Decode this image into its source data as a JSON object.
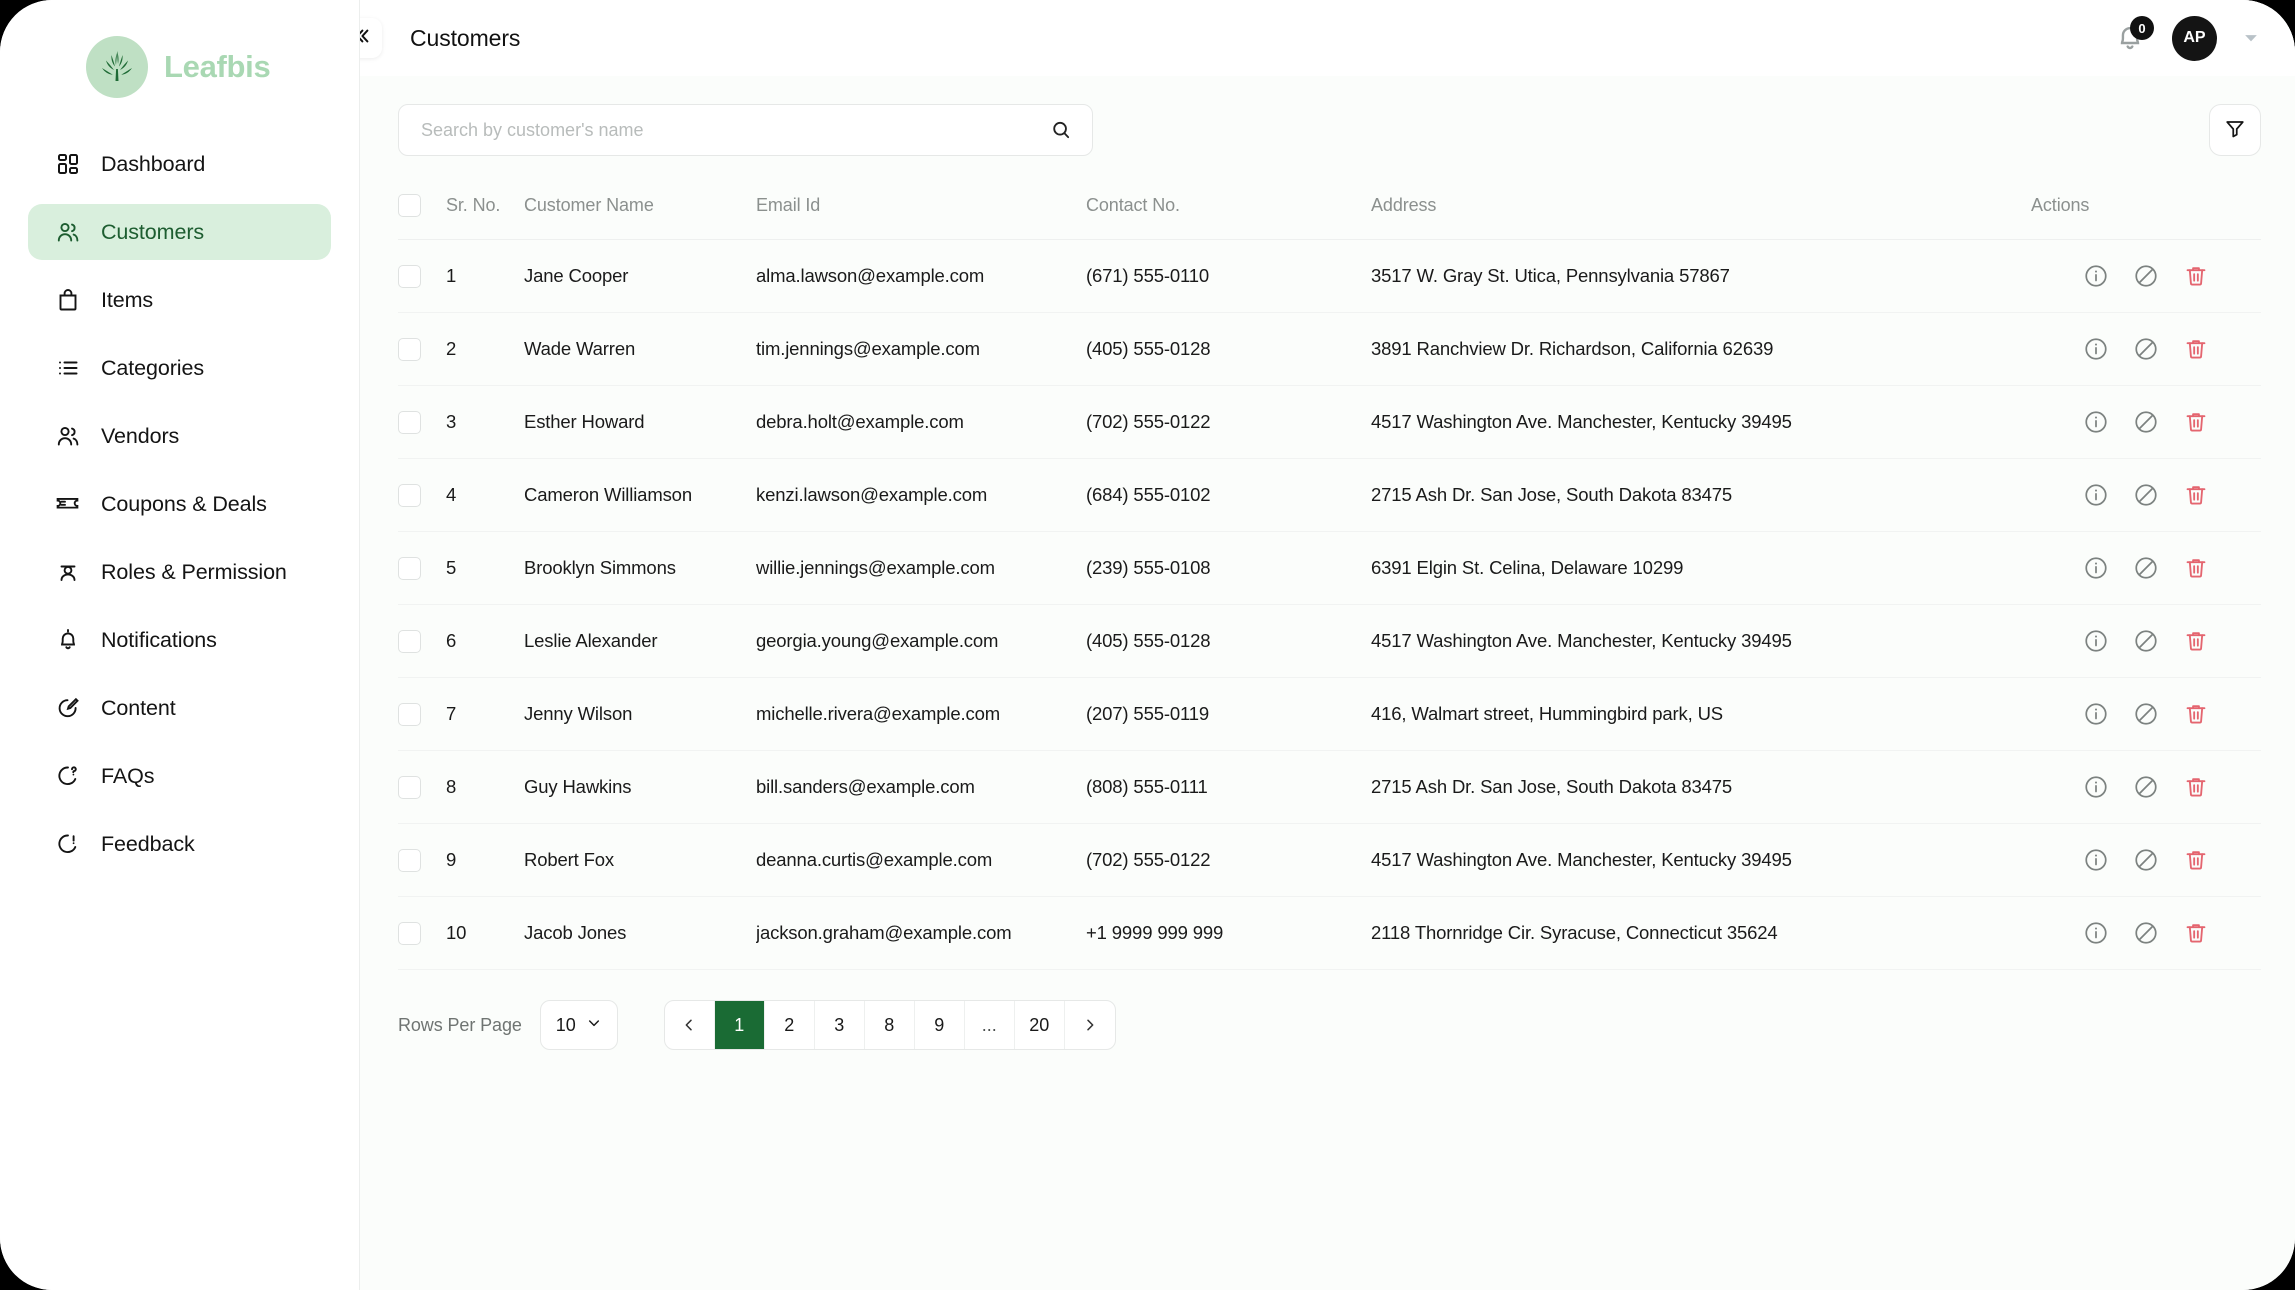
{
  "brand": {
    "name": "Leafbis",
    "logo_icon": "cannabis-leaf-icon",
    "logo_bg": "#bfe0c4",
    "text_color": "#a9d8b3"
  },
  "sidebar": {
    "items": [
      {
        "label": "Dashboard",
        "icon": "grid-dashboard-icon",
        "active": false
      },
      {
        "label": "Customers",
        "icon": "users-icon",
        "active": true
      },
      {
        "label": "Items",
        "icon": "bag-icon",
        "active": false
      },
      {
        "label": "Categories",
        "icon": "list-icon",
        "active": false
      },
      {
        "label": "Vendors",
        "icon": "users-icon",
        "active": false
      },
      {
        "label": "Coupons & Deals",
        "icon": "ticket-icon",
        "active": false
      },
      {
        "label": "Roles & Permission",
        "icon": "user-badge-icon",
        "active": false
      },
      {
        "label": "Notifications",
        "icon": "bell-icon",
        "active": false
      },
      {
        "label": "Content",
        "icon": "pencil-edit-icon",
        "active": false
      },
      {
        "label": "FAQs",
        "icon": "question-chat-icon",
        "active": false
      },
      {
        "label": "Feedback",
        "icon": "feedback-chat-icon",
        "active": false
      }
    ]
  },
  "header": {
    "title": "Customers",
    "collapse_icon": "double-chevron-left-icon",
    "notification_icon": "bell-icon",
    "notification_count": "0",
    "avatar_initials": "AP",
    "caret_icon": "chevron-down-icon"
  },
  "toolbar": {
    "search_placeholder": "Search by customer's name",
    "search_value": "",
    "search_icon": "search-icon",
    "filter_icon": "filter-funnel-icon"
  },
  "table": {
    "columns": [
      "Sr. No.",
      "Customer Name",
      "Email Id",
      "Contact No.",
      "Address",
      "Actions"
    ],
    "action_icons": [
      "info-circle-icon",
      "block-ban-icon",
      "trash-delete-icon"
    ],
    "rows": [
      {
        "sr": "1",
        "name": "Jane Cooper",
        "email": "alma.lawson@example.com",
        "phone": "(671) 555-0110",
        "address": "3517 W. Gray St. Utica, Pennsylvania 57867"
      },
      {
        "sr": "2",
        "name": "Wade Warren",
        "email": "tim.jennings@example.com",
        "phone": "(405) 555-0128",
        "address": "3891 Ranchview Dr. Richardson, California 62639"
      },
      {
        "sr": "3",
        "name": "Esther Howard",
        "email": "debra.holt@example.com",
        "phone": "(702) 555-0122",
        "address": "4517 Washington Ave. Manchester, Kentucky 39495"
      },
      {
        "sr": "4",
        "name": "Cameron Williamson",
        "email": "kenzi.lawson@example.com",
        "phone": "(684) 555-0102",
        "address": "2715 Ash Dr. San Jose, South Dakota 83475"
      },
      {
        "sr": "5",
        "name": "Brooklyn Simmons",
        "email": "willie.jennings@example.com",
        "phone": "(239) 555-0108",
        "address": "6391 Elgin St. Celina, Delaware 10299"
      },
      {
        "sr": "6",
        "name": "Leslie Alexander",
        "email": "georgia.young@example.com",
        "phone": "(405) 555-0128",
        "address": "4517 Washington Ave. Manchester, Kentucky 39495"
      },
      {
        "sr": "7",
        "name": "Jenny Wilson",
        "email": "michelle.rivera@example.com",
        "phone": "(207) 555-0119",
        "address": "416, Walmart street, Hummingbird park, US"
      },
      {
        "sr": "8",
        "name": "Guy Hawkins",
        "email": "bill.sanders@example.com",
        "phone": "(808) 555-0111",
        "address": "2715 Ash Dr. San Jose, South Dakota 83475"
      },
      {
        "sr": "9",
        "name": "Robert Fox",
        "email": "deanna.curtis@example.com",
        "phone": "(702) 555-0122",
        "address": "4517 Washington Ave. Manchester, Kentucky 39495"
      },
      {
        "sr": "10",
        "name": "Jacob Jones",
        "email": "jackson.graham@example.com",
        "phone": "+1 9999 999 999",
        "address": "2118 Thornridge Cir. Syracuse, Connecticut 35624"
      }
    ]
  },
  "pagination": {
    "rows_per_page_label": "Rows Per Page",
    "rows_per_page_value": "10",
    "rows_per_page_caret": "chevron-down-icon",
    "prev_icon": "chevron-left-icon",
    "next_icon": "chevron-right-icon",
    "pages": [
      "1",
      "2",
      "3",
      "8",
      "9",
      "...",
      "20"
    ],
    "active_page": "1",
    "active_color": "#1a6b34"
  }
}
